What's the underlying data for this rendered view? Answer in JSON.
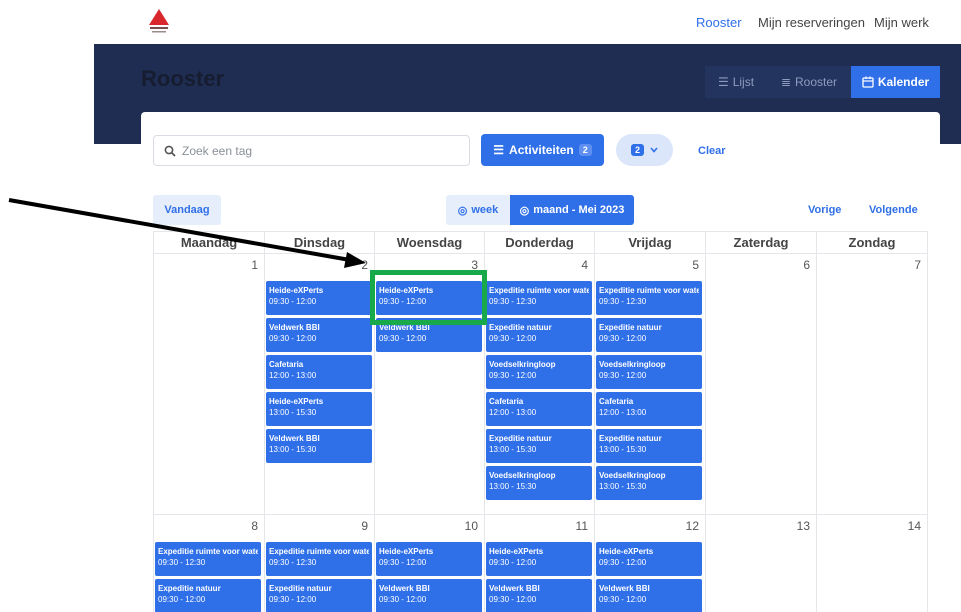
{
  "nav": {
    "rooster": "Rooster",
    "reservations": "Mijn reserveringen",
    "work": "Mijn werk"
  },
  "page": {
    "title": "Rooster"
  },
  "views": {
    "list": "Lijst",
    "schedule": "Rooster",
    "calendar": "Kalender"
  },
  "filters": {
    "search_placeholder": "Zoek een tag",
    "activities": "Activiteiten",
    "activities_count": "2",
    "selected_count": "2",
    "clear": "Clear"
  },
  "calnav": {
    "today": "Vandaag",
    "week": "week",
    "month": "maand - Mei 2023",
    "prev": "Vorige",
    "next": "Volgende"
  },
  "weekdays": [
    "Maandag",
    "Dinsdag",
    "Woensdag",
    "Donderdag",
    "Vrijdag",
    "Zaterdag",
    "Zondag"
  ],
  "weeks": [
    {
      "days": [
        {
          "num": "1",
          "events": []
        },
        {
          "num": "2",
          "events": [
            {
              "title": "Heide-eXPerts",
              "time": "09:30 - 12:00"
            },
            {
              "title": "Veldwerk BBI",
              "time": "09:30 - 12:00"
            },
            {
              "title": "Cafetaria",
              "time": "12:00 - 13:00"
            },
            {
              "title": "Heide-eXPerts",
              "time": "13:00 - 15:30"
            },
            {
              "title": "Veldwerk BBI",
              "time": "13:00 - 15:30"
            }
          ]
        },
        {
          "num": "3",
          "events": [
            {
              "title": "Heide-eXPerts",
              "time": "09:30 - 12:00"
            },
            {
              "title": "Veldwerk BBI",
              "time": "09:30 - 12:00"
            }
          ]
        },
        {
          "num": "4",
          "events": [
            {
              "title": "Expeditie ruimte voor water",
              "time": "09:30 - 12:30"
            },
            {
              "title": "Expeditie natuur",
              "time": "09:30 - 12:00"
            },
            {
              "title": "Voedselkringloop",
              "time": "09:30 - 12:00"
            },
            {
              "title": "Cafetaria",
              "time": "12:00 - 13:00"
            },
            {
              "title": "Expeditie natuur",
              "time": "13:00 - 15:30"
            },
            {
              "title": "Voedselkringloop",
              "time": "13:00 - 15:30"
            }
          ]
        },
        {
          "num": "5",
          "events": [
            {
              "title": "Expeditie ruimte voor water",
              "time": "09:30 - 12:30"
            },
            {
              "title": "Expeditie natuur",
              "time": "09:30 - 12:00"
            },
            {
              "title": "Voedselkringloop",
              "time": "09:30 - 12:00"
            },
            {
              "title": "Cafetaria",
              "time": "12:00 - 13:00"
            },
            {
              "title": "Expeditie natuur",
              "time": "13:00 - 15:30"
            },
            {
              "title": "Voedselkringloop",
              "time": "13:00 - 15:30"
            }
          ]
        },
        {
          "num": "6",
          "events": []
        },
        {
          "num": "7",
          "events": []
        }
      ]
    },
    {
      "days": [
        {
          "num": "8",
          "events": [
            {
              "title": "Expeditie ruimte voor water",
              "time": "09:30 - 12:30"
            },
            {
              "title": "Expeditie natuur",
              "time": "09:30 - 12:00"
            }
          ]
        },
        {
          "num": "9",
          "events": [
            {
              "title": "Expeditie ruimte voor water",
              "time": "09:30 - 12:30"
            },
            {
              "title": "Expeditie natuur",
              "time": "09:30 - 12:00"
            }
          ]
        },
        {
          "num": "10",
          "events": [
            {
              "title": "Heide-eXPerts",
              "time": "09:30 - 12:00"
            },
            {
              "title": "Veldwerk BBI",
              "time": "09:30 - 12:00"
            }
          ]
        },
        {
          "num": "11",
          "events": [
            {
              "title": "Heide-eXPerts",
              "time": "09:30 - 12:00"
            },
            {
              "title": "Veldwerk BBI",
              "time": "09:30 - 12:00"
            }
          ]
        },
        {
          "num": "12",
          "events": [
            {
              "title": "Heide-eXPerts",
              "time": "09:30 - 12:00"
            },
            {
              "title": "Veldwerk BBI",
              "time": "09:30 - 12:00"
            }
          ]
        },
        {
          "num": "13",
          "events": []
        },
        {
          "num": "14",
          "events": []
        }
      ]
    }
  ]
}
